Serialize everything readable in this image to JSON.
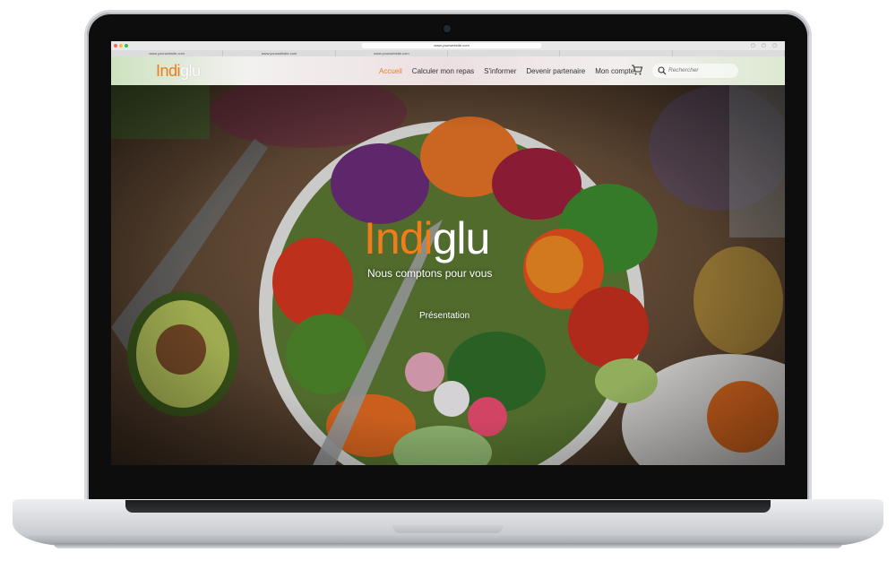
{
  "browser": {
    "url": "www.yourwebsite.com",
    "tabs": [
      "www.yourwebsite.com",
      "www.yourwebsite.com",
      "www.yourwebsite.com",
      "",
      "",
      ""
    ]
  },
  "site": {
    "logo": {
      "part1": "Indi",
      "part2": "glu"
    },
    "nav": [
      {
        "label": "Accueil",
        "active": true
      },
      {
        "label": "Calculer mon repas"
      },
      {
        "label": "S'informer"
      },
      {
        "label": "Devenir partenaire"
      },
      {
        "label": "Mon compte"
      }
    ],
    "search": {
      "placeholder": "Rechercher"
    }
  },
  "hero": {
    "title_part1": "Indi",
    "title_part2": "glu",
    "subtitle": "Nous comptons pour vous",
    "button": "Présentation"
  },
  "colors": {
    "accent": "#ee7d1c",
    "text": "#333333"
  },
  "icons": [
    "cart-icon",
    "search-icon"
  ]
}
